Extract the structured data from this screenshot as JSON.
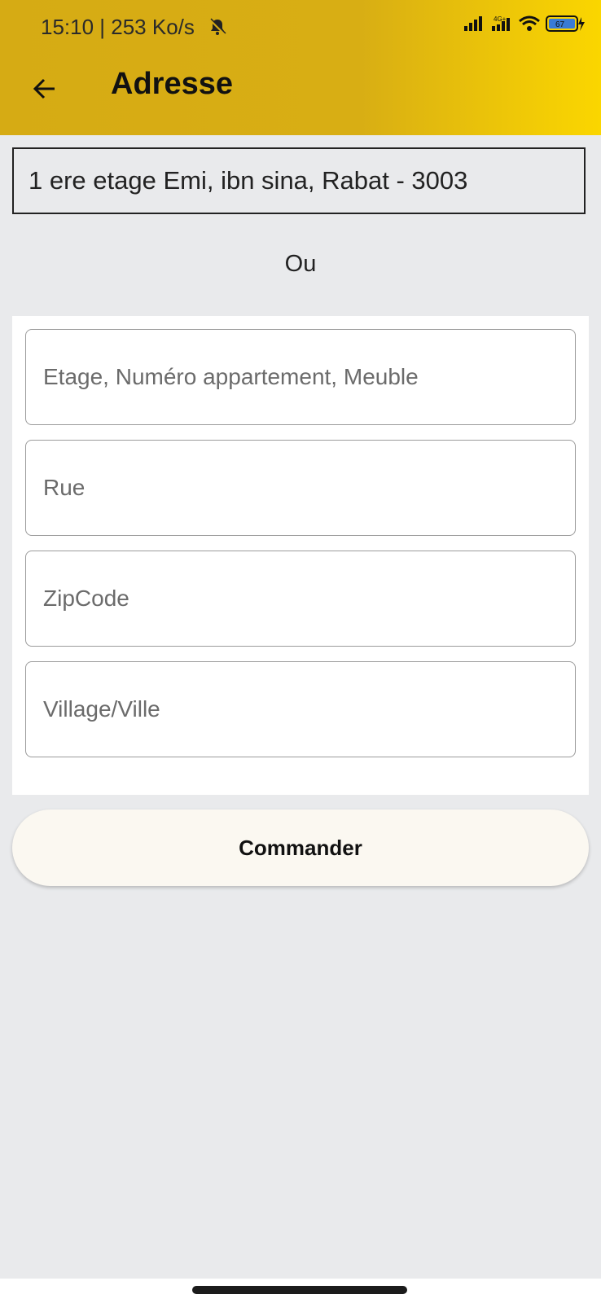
{
  "status_bar": {
    "time_speed": "15:10 | 253 Ko/s",
    "network_type": "4G+",
    "battery_level": "67"
  },
  "header": {
    "title": "Adresse",
    "back_icon": "arrow-left-icon",
    "colors": {
      "start": "#d6ab14",
      "end": "#fbd600"
    }
  },
  "saved_address": "1 ere etage Emi, ibn sina, Rabat - 3003",
  "separator": "Ou",
  "form": {
    "floor_apartment": {
      "placeholder": "Etage, Numéro appartement, Meuble",
      "value": ""
    },
    "street": {
      "placeholder": "Rue",
      "value": ""
    },
    "zip": {
      "placeholder": "ZipCode",
      "value": ""
    },
    "city": {
      "placeholder": "Village/Ville",
      "value": ""
    }
  },
  "submit_label": "Commander"
}
